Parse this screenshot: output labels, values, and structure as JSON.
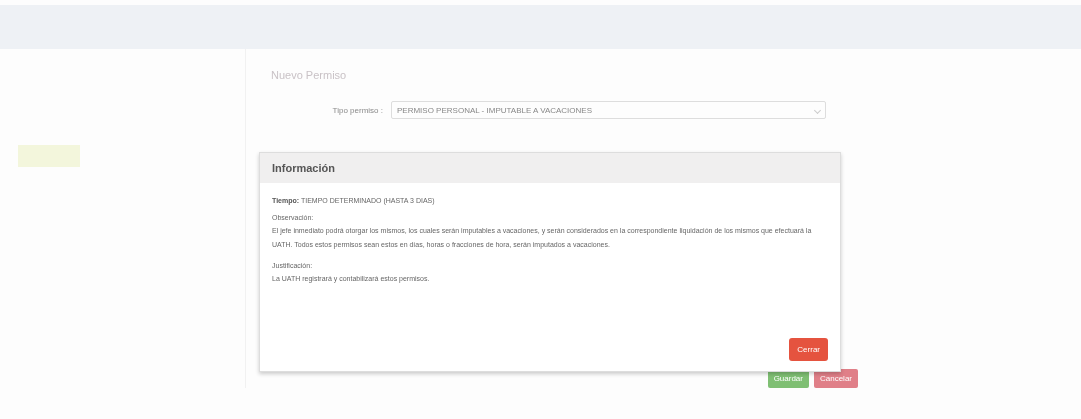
{
  "page": {
    "panel_title": "Nuevo Permiso",
    "type_label": "Tipo permiso :",
    "type_value": "PERMISO PERSONAL - IMPUTABLE A VACACIONES",
    "buttons": [
      {
        "label": "Guardar",
        "kind": "save"
      },
      {
        "label": "Cancelar",
        "kind": "cancel"
      }
    ]
  },
  "modal": {
    "title": "Información",
    "tiempo_label": "Tiempo:",
    "tiempo_value": "TIEMPO DETERMINADO (HASTA 3 DIAS)",
    "observacion_label": "Observación:",
    "observacion_text": "El jefe inmediato podrá otorgar los mismos, los cuales serán imputables a vacaciones, y serán considerados en la correspondiente liquidación de los mismos que efectuará la UATH. Todos estos permisos sean estos en días, horas o fracciones de hora, serán imputados a vacaciones.",
    "justificacion_label": "Justificación:",
    "justificacion_text": "La UATH registrará y contabilizará estos permisos.",
    "close_button": "Cerrar"
  }
}
